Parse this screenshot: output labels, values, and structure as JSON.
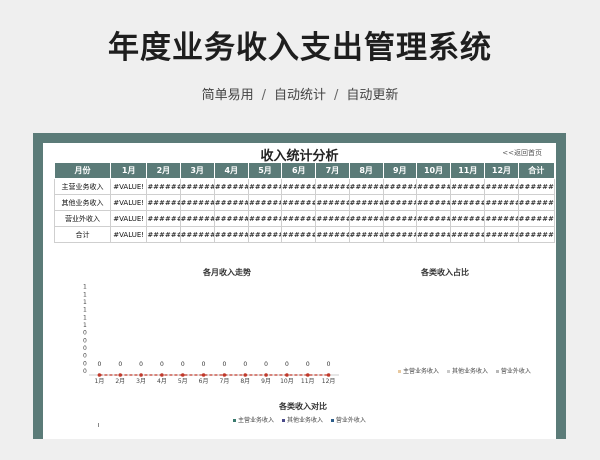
{
  "page": {
    "title": "年度业务收入支出管理系统",
    "subtitle": [
      "简单易用",
      "自动统计",
      "自动更新"
    ],
    "separator": "/"
  },
  "sheet": {
    "title": "收入统计分析",
    "back_link": "<<返回首页",
    "table": {
      "columns": [
        "月份",
        "1月",
        "2月",
        "3月",
        "4月",
        "5月",
        "6月",
        "7月",
        "8月",
        "9月",
        "10月",
        "11月",
        "12月",
        "合计"
      ],
      "rows": [
        {
          "label": "主营业务收入",
          "cells": [
            "#VALUE!",
            "######",
            "######",
            "######",
            "######",
            "######",
            "######",
            "######",
            "######",
            "######",
            "######",
            "######",
            "######"
          ]
        },
        {
          "label": "其他业务收入",
          "cells": [
            "#VALUE!",
            "######",
            "######",
            "######",
            "######",
            "######",
            "######",
            "######",
            "######",
            "######",
            "######",
            "######",
            "######"
          ]
        },
        {
          "label": "营业外收入",
          "cells": [
            "#VALUE!",
            "######",
            "######",
            "######",
            "######",
            "######",
            "######",
            "######",
            "######",
            "######",
            "######",
            "######",
            "######"
          ]
        },
        {
          "label": "合计",
          "cells": [
            "#VALUE!",
            "######",
            "######",
            "######",
            "######",
            "######",
            "######",
            "######",
            "######",
            "######",
            "######",
            "######",
            "######"
          ]
        }
      ]
    }
  },
  "chart_data": [
    {
      "type": "line",
      "title": "各月收入走势",
      "categories": [
        "1月",
        "2月",
        "3月",
        "4月",
        "5月",
        "6月",
        "7月",
        "8月",
        "9月",
        "10月",
        "11月",
        "12月"
      ],
      "series": [
        {
          "values": [
            0,
            0,
            0,
            0,
            0,
            0,
            0,
            0,
            0,
            0,
            0,
            0
          ]
        }
      ],
      "data_labels": [
        "0",
        "0",
        "0",
        "0",
        "0",
        "0",
        "0",
        "0",
        "0",
        "0",
        "0",
        "0"
      ],
      "yticks": [
        "1",
        "1",
        "1",
        "1",
        "1",
        "1",
        "0",
        "0",
        "0",
        "0",
        "0",
        "0"
      ],
      "line_color": "#c0392b"
    },
    {
      "type": "pie",
      "title": "各类收入占比",
      "legend": [
        "主营业务收入",
        "其他业务收入",
        "营业外收入"
      ],
      "legend_colors": [
        "#e8c9a0",
        "#c9c9c9",
        "#b8b8b8"
      ]
    },
    {
      "type": "bar",
      "title": "各类收入对比",
      "legend": [
        "主营业务收入",
        "其他业务收入",
        "营业外收入"
      ],
      "legend_colors": [
        "#3a7a6e",
        "#4a4a8a",
        "#2d5e8a"
      ]
    }
  ],
  "colors": {
    "frame": "#5b7b78",
    "header": "#5b7b78"
  }
}
